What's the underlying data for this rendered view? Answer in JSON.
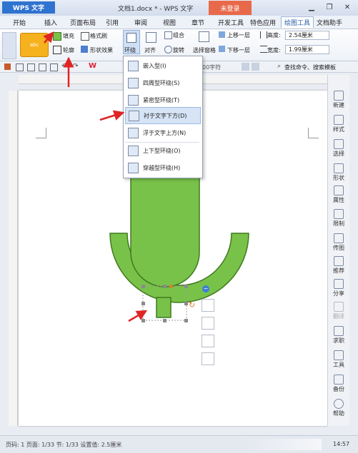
{
  "title_bar": {
    "app_button": "WPS 文字",
    "document_title": "文档1.docx * - WPS 文字",
    "login_button": "未登录",
    "window_controls": [
      "minimize-icon",
      "restore-icon",
      "close-icon"
    ]
  },
  "menu_tabs": [
    "开始",
    "插入",
    "页面布局",
    "引用",
    "审阅",
    "视图",
    "章节",
    "开发工具",
    "特色应用",
    "绘图工具",
    "文档助手"
  ],
  "active_tab": "绘图工具",
  "ribbon": {
    "fill_label": "填充",
    "format_painter_label": "格式刷",
    "outline_label": "轮廓",
    "shape_effect_label": "形状效果",
    "wrap_label": "环绕",
    "align_label": "对齐",
    "rotate_label": "旋转",
    "group_label": "组合",
    "selection_pane_label": "选择窗格",
    "bring_forward_label": "上移一层",
    "send_backward_label": "下移一层",
    "height_label": "高度:",
    "height_value": "2.54厘米",
    "width_label": "宽度:",
    "width_value": "1.99厘米",
    "style_preview_text": "abc"
  },
  "quickbar": {
    "char_hint": "00字符",
    "search_text": "查找命令、搜索模板"
  },
  "wrap_menu": {
    "items": [
      "嵌入型(I)",
      "四周型环绕(S)",
      "紧密型环绕(T)",
      "衬于文字下方(D)",
      "浮于文字上方(N)",
      "上下型环绕(O)",
      "穿越型环绕(H)"
    ],
    "selected": "衬于文字下方(D)"
  },
  "right_panel": {
    "items": [
      "新建",
      "样式",
      "选择",
      "形状",
      "属性",
      "限制",
      "传图",
      "推荐",
      "分享",
      "翻译",
      "求职",
      "工具",
      "备份",
      "帮助"
    ]
  },
  "floating_toolbar": {
    "icons": [
      "layout-options-icon",
      "edit-shape-icon",
      "fill-color-icon",
      "outline-color-icon"
    ]
  },
  "status_bar": {
    "text": "页码: 1  页面: 1/33  节: 1/33  设置值: 2.5厘米",
    "time": "14:57"
  },
  "colors": {
    "shape_fill": "#79c24a",
    "shape_stroke": "#3f7a1e",
    "accent_blue": "#2f73d0",
    "login_orange": "#e8694a",
    "annotation_red": "#e02424",
    "selection_blue": "#d6e4f6"
  }
}
